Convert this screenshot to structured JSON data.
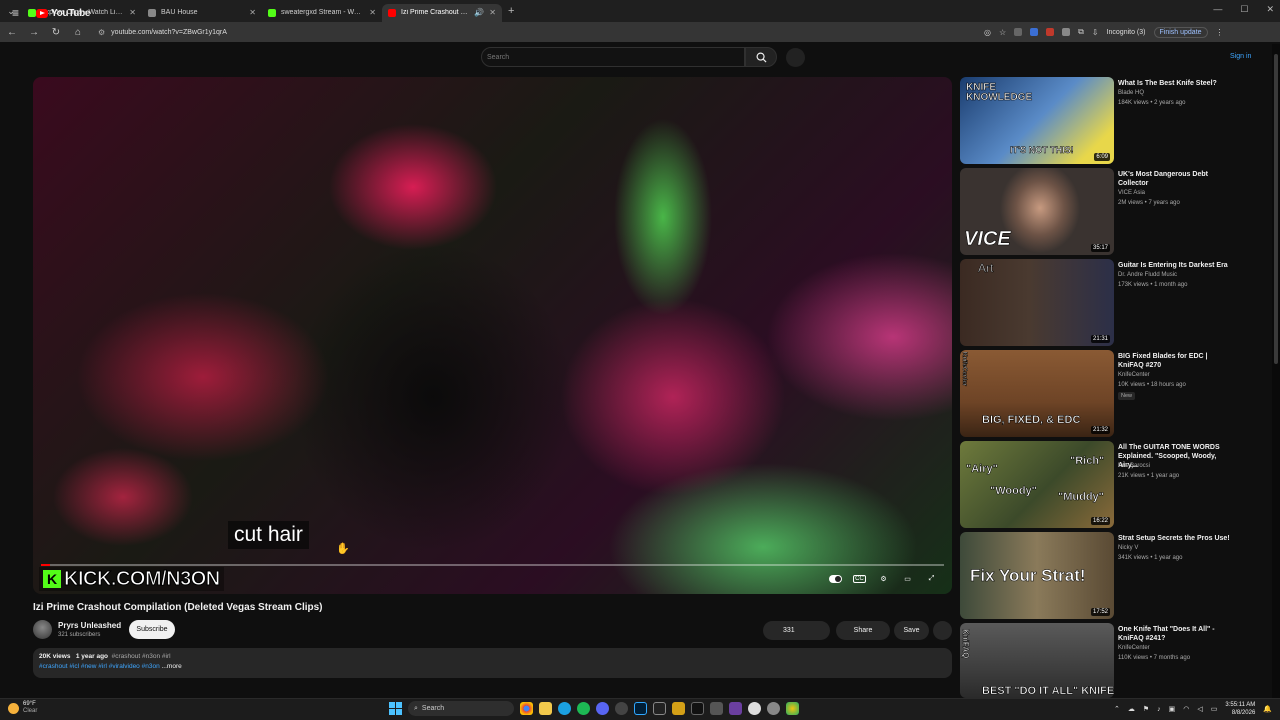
{
  "browser": {
    "tabs": [
      {
        "title": "Explore Clips - Watch Live on Kick",
        "color": "#53fc18"
      },
      {
        "title": "BAU House",
        "color": "#888888"
      },
      {
        "title": "sweatergxd Stream - Watch Live",
        "color": "#53fc18"
      },
      {
        "title": "Izi Prime Crashout Compilation",
        "color": "#ff0000"
      }
    ],
    "url": "youtube.com/watch?v=ZBwGr1y1qrA",
    "incognito_label": "Incognito (3)",
    "finish_update_label": "Finish update"
  },
  "youtube": {
    "logo_text": "YouTube",
    "search_placeholder": "Search",
    "sign_in_label": "Sign in"
  },
  "player": {
    "caption": "cut hair",
    "watermark": "KICK.COM/N3ON",
    "progress_fraction": 0.01
  },
  "video": {
    "title": "Izi Prime Crashout Compilation (Deleted Vegas Stream Clips)",
    "channel": "Pryrs Unleashed",
    "subscribers": "321 subscribers",
    "subscribe_label": "Subscribe",
    "likes": "331",
    "share_label": "Share",
    "save_label": "Save",
    "views": "20K views",
    "age": "1 year ago",
    "top_tags": "#crashout #n3on #irl",
    "hashtags": "#crashout #icl #new #irl #viralvideo #n3on",
    "more_label": "...more"
  },
  "recommendations": [
    {
      "title": "What Is The Best Knife Steel?",
      "channel": "Blade HQ",
      "meta": "184K views • 2 years ago",
      "duration": "6:09",
      "thumb_text": "KNIFE KNOWLEDGE",
      "thumb_text2": "IT'S NOT THIS!"
    },
    {
      "title": "UK's Most Dangerous Debt Collector",
      "channel": "VICE Asia",
      "meta": "2M views • 7 years ago",
      "duration": "35:17",
      "thumb_text": "VICE"
    },
    {
      "title": "Guitar Is Entering Its Darkest Era",
      "channel": "Dr. Andre Fludd Music",
      "meta": "173K views • 1 month ago",
      "duration": "21:31",
      "thumb_text": "Art"
    },
    {
      "title": "BIG Fixed Blades for EDC | KniFAQ #270",
      "channel": "KnifeCenter",
      "meta": "10K views • 18 hours ago",
      "duration": "21:32",
      "badge": "New",
      "thumb_text": "BIG, FIXED, & EDC",
      "thumb_text2": "KnifeCenter"
    },
    {
      "title": "All The GUITAR TONE WORDS Explained. \"Scooped, Woody, Airy,...",
      "channel": "Kris Barocsi",
      "meta": "21K views • 1 year ago",
      "duration": "16:22",
      "thumb_text": "\"Airy\"",
      "thumb_text2": "\"Rich\"",
      "thumb_text3": "\"Woody\"",
      "thumb_text4": "\"Muddy\""
    },
    {
      "title": "Strat Setup Secrets the Pros Use!",
      "channel": "Nicky V",
      "meta": "341K views • 1 year ago",
      "duration": "17:52",
      "thumb_text": "Fix Your Strat!"
    },
    {
      "title": "One Knife That \"Does It All\" - KniFAQ #241?",
      "channel": "KnifeCenter",
      "meta": "110K views • 7 months ago",
      "duration": "",
      "thumb_text": "BEST \"DO IT ALL\" KNIFE?",
      "thumb_text2": "KniFAQ"
    }
  ],
  "taskbar": {
    "temperature": "69°F",
    "condition": "Clear",
    "search_label": "Search",
    "time": "3:55:11 AM",
    "date": "8/8/2026"
  }
}
